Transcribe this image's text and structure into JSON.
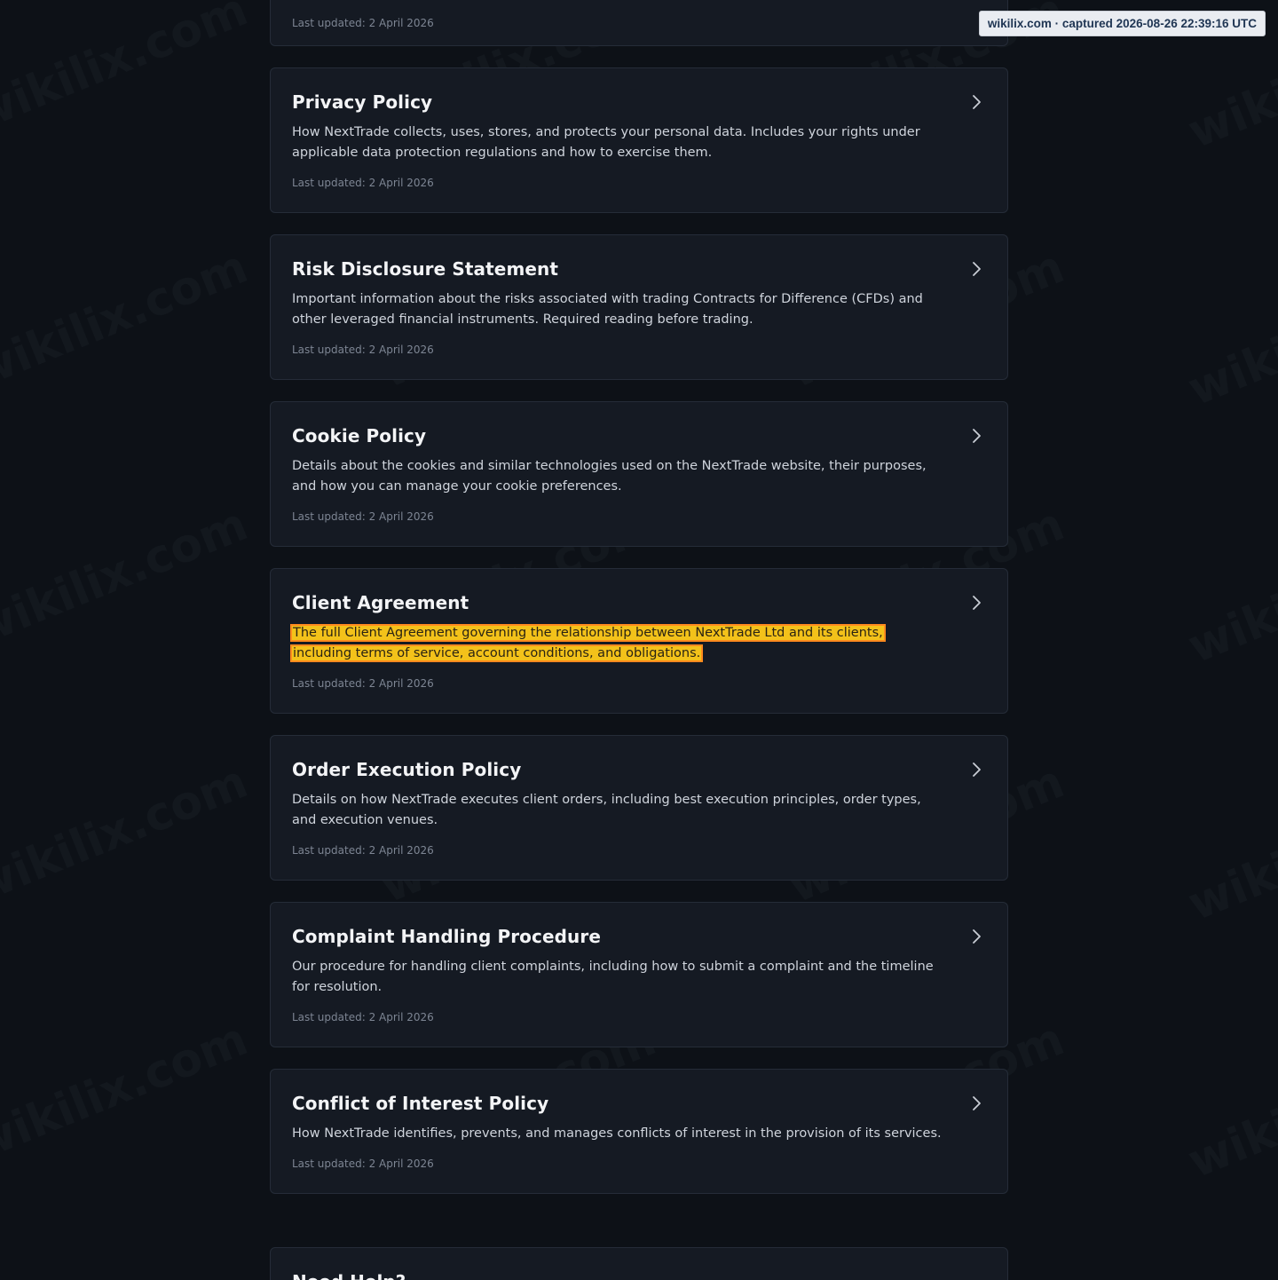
{
  "capture": {
    "label": "wikilix.com · captured 2026-08-26 22:39:16 UTC"
  },
  "watermark": {
    "text": "wikilix.com"
  },
  "policies": [
    {
      "title": "",
      "description": "",
      "updated": "Last updated: 2 April 2026"
    },
    {
      "title": "Privacy Policy",
      "description": "How NextTrade collects, uses, stores, and protects your personal data. Includes your rights under applicable data protection regulations and how to exercise them.",
      "updated": "Last updated: 2 April 2026"
    },
    {
      "title": "Risk Disclosure Statement",
      "description": "Important information about the risks associated with trading Contracts for Difference (CFDs) and other leveraged financial instruments. Required reading before trading.",
      "updated": "Last updated: 2 April 2026"
    },
    {
      "title": "Cookie Policy",
      "description": "Details about the cookies and similar technologies used on the NextTrade website, their purposes, and how you can manage your cookie preferences.",
      "updated": "Last updated: 2 April 2026"
    },
    {
      "title": "Client Agreement",
      "description": "The full Client Agreement governing the relationship between NextTrade Ltd and its clients, including terms of service, account conditions, and obligations.",
      "updated": "Last updated: 2 April 2026"
    },
    {
      "title": "Order Execution Policy",
      "description": "Details on how NextTrade executes client orders, including best execution principles, order types, and execution venues.",
      "updated": "Last updated: 2 April 2026"
    },
    {
      "title": "Complaint Handling Procedure",
      "description": "Our procedure for handling client complaints, including how to submit a complaint and the timeline for resolution.",
      "updated": "Last updated: 2 April 2026"
    },
    {
      "title": "Conflict of Interest Policy",
      "description": "How NextTrade identifies, prevents, and manages conflicts of interest in the provision of its services.",
      "updated": "Last updated: 2 April 2026"
    }
  ],
  "help": {
    "title": "Need Help?"
  },
  "colors": {
    "background": "#0d1117",
    "card": "#151a23",
    "highlight": "#f3c21a",
    "highlight_border": "#ff8a1e"
  }
}
